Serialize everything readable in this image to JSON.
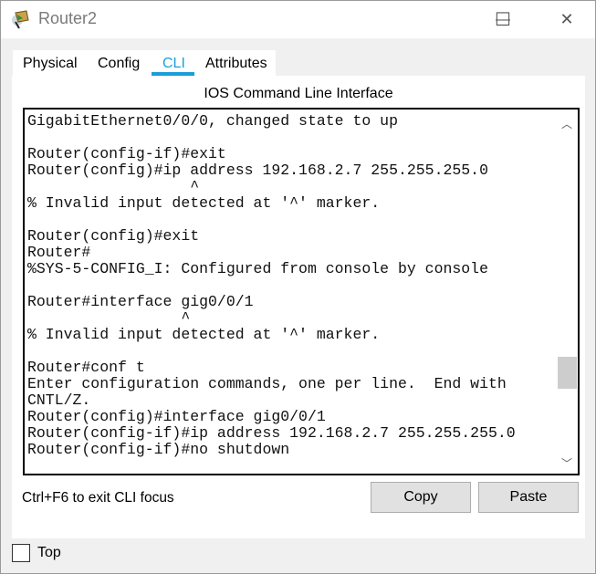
{
  "window": {
    "title": "Router2",
    "icon": "router-icon"
  },
  "window_controls": {
    "minimize": "—",
    "maximize": "☐",
    "close": "✕"
  },
  "tabs": [
    {
      "label": "Physical",
      "active": false
    },
    {
      "label": "Config",
      "active": false
    },
    {
      "label": "CLI",
      "active": true
    },
    {
      "label": "Attributes",
      "active": false
    }
  ],
  "accent_color": "#1a9ed6",
  "cli": {
    "heading": "IOS Command Line Interface",
    "lines": [
      "GigabitEthernet0/0/0, changed state to up",
      "",
      "Router(config-if)#exit",
      "Router(config)#ip address 192.168.2.7 255.255.255.0",
      "                  ^",
      "% Invalid input detected at '^' marker.",
      "",
      "Router(config)#exit",
      "Router#",
      "%SYS-5-CONFIG_I: Configured from console by console",
      "",
      "Router#interface gig0/0/1",
      "                 ^",
      "% Invalid input detected at '^' marker.",
      "",
      "Router#conf t",
      "Enter configuration commands, one per line.  End with",
      "CNTL/Z.",
      "Router(config)#interface gig0/0/1",
      "Router(config-if)#ip address 192.168.2.7 255.255.255.0",
      "Router(config-if)#no shutdown"
    ],
    "hint": "Ctrl+F6 to exit CLI focus",
    "copy_label": "Copy",
    "paste_label": "Paste"
  },
  "top_checkbox": {
    "label": "Top",
    "checked": false
  }
}
